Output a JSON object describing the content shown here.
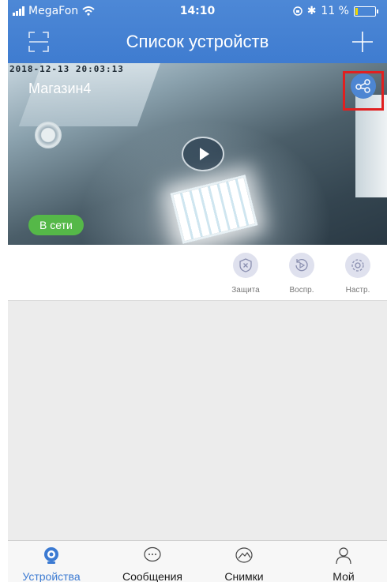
{
  "status_bar": {
    "carrier": "MegaFon",
    "time": "14:10",
    "battery": "11 %",
    "battery_level": 0.11
  },
  "header": {
    "title": "Список устройств"
  },
  "camera": {
    "timestamp": "2018-12-13 20:03:13",
    "name": "Магазин4",
    "status": "В сети"
  },
  "actions": [
    {
      "label": "Защита",
      "icon": "shield-x-icon"
    },
    {
      "label": "Воспр.",
      "icon": "replay-icon"
    },
    {
      "label": "Настр.",
      "icon": "gear-icon"
    }
  ],
  "tabs": [
    {
      "label": "Устройства",
      "icon": "camera-icon",
      "active": true
    },
    {
      "label": "Сообщения",
      "icon": "chat-icon",
      "active": false
    },
    {
      "label": "Снимки",
      "icon": "photo-icon",
      "active": false
    },
    {
      "label": "Мой",
      "icon": "user-icon",
      "active": false
    }
  ],
  "colors": {
    "header": "#4d88d6",
    "online": "#55b848",
    "highlight": "#e02020",
    "active_tab": "#3b7ad2"
  }
}
